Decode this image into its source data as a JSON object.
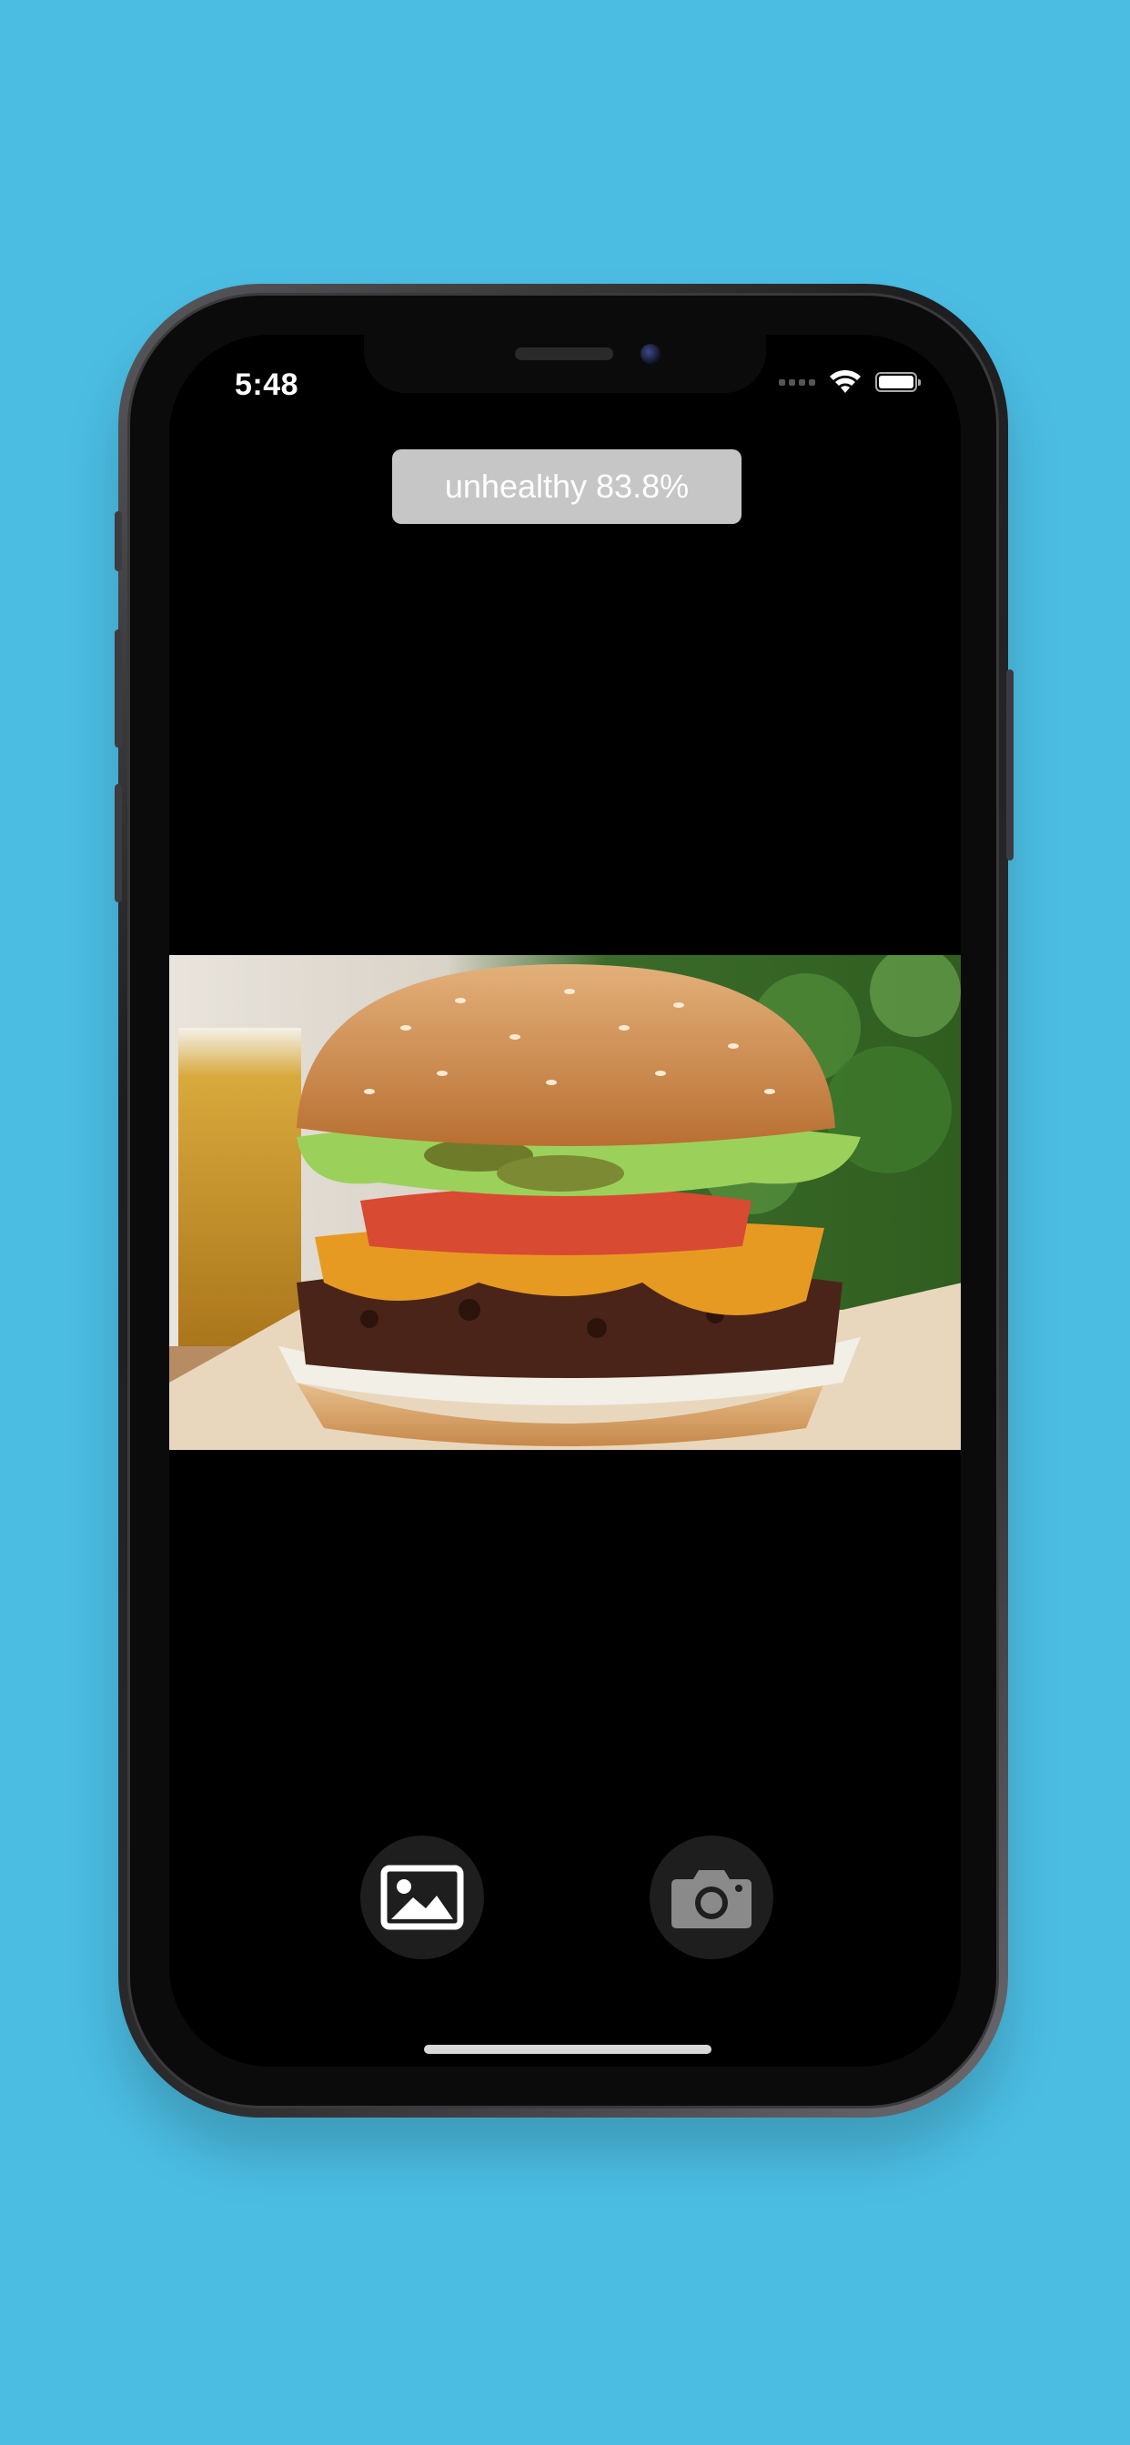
{
  "status_bar": {
    "time": "5:48"
  },
  "result": {
    "label": "unhealthy 83.8%"
  },
  "image": {
    "subject": "cheeseburger-photo"
  },
  "actions": {
    "gallery_icon": "photo-library-icon",
    "camera_icon": "camera-icon"
  },
  "colors": {
    "background": "#4bbde3",
    "screen": "#000000",
    "badge": "#c6c6c6"
  }
}
